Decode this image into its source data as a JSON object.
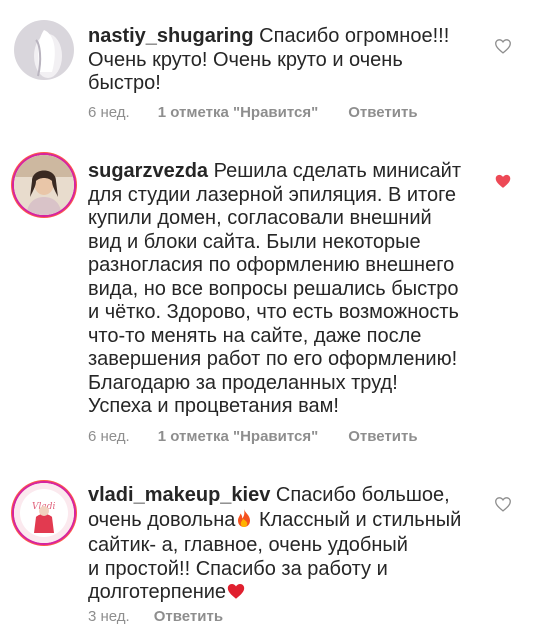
{
  "comments": [
    {
      "username": "nastiy_shugaring",
      "lines": [
        "Спасибо огромное!!!",
        "Очень круто! Очень круто и очень",
        "быстро!"
      ],
      "time": "6 нед.",
      "likes": "1 отметка \"Нравится\"",
      "reply": "Ответить",
      "liked": false,
      "avatar_icon": "profile-photo"
    },
    {
      "username": "sugarzvezda",
      "lines": [
        "Решила сделать минисайт",
        "для студии лазерной эпиляция. В итоге",
        "купили домен, согласовали внешний",
        "вид и блоки сайта. Были некоторые",
        "разногласия по оформлению внешнего",
        "вида, но все вопросы решались быстро",
        "и чётко. Здорово, что есть возможность",
        "что-то менять на сайте, даже после",
        "завершения работ по его оформлению!",
        "Благодарю за проделанных труд!",
        "Успеха и процветания вам!"
      ],
      "time": "6 нед.",
      "likes": "1 отметка \"Нравится\"",
      "reply": "Ответить",
      "liked": true,
      "avatar_icon": "profile-photo-story-ring"
    },
    {
      "username": "vladi_makeup_kiev",
      "lines": [
        "Спасибо большое,",
        "очень довольна",
        "Классный и стильный",
        "сайтик- а, главное, очень удобный",
        "и простой!! Спасибо за работу и",
        "долготерпение"
      ],
      "time": "3 нед.",
      "reply": "Ответить",
      "liked": false,
      "avatar_icon": "profile-photo-story-ring"
    }
  ],
  "colors": {
    "text": "#262626",
    "meta": "#8e8e8e",
    "heart_outline": "#8e8e8e",
    "heart_liked": "#ed4956"
  },
  "icons": [
    "heart-outline-icon",
    "heart-filled-icon",
    "fire-emoji-icon",
    "red-heart-emoji-icon"
  ]
}
